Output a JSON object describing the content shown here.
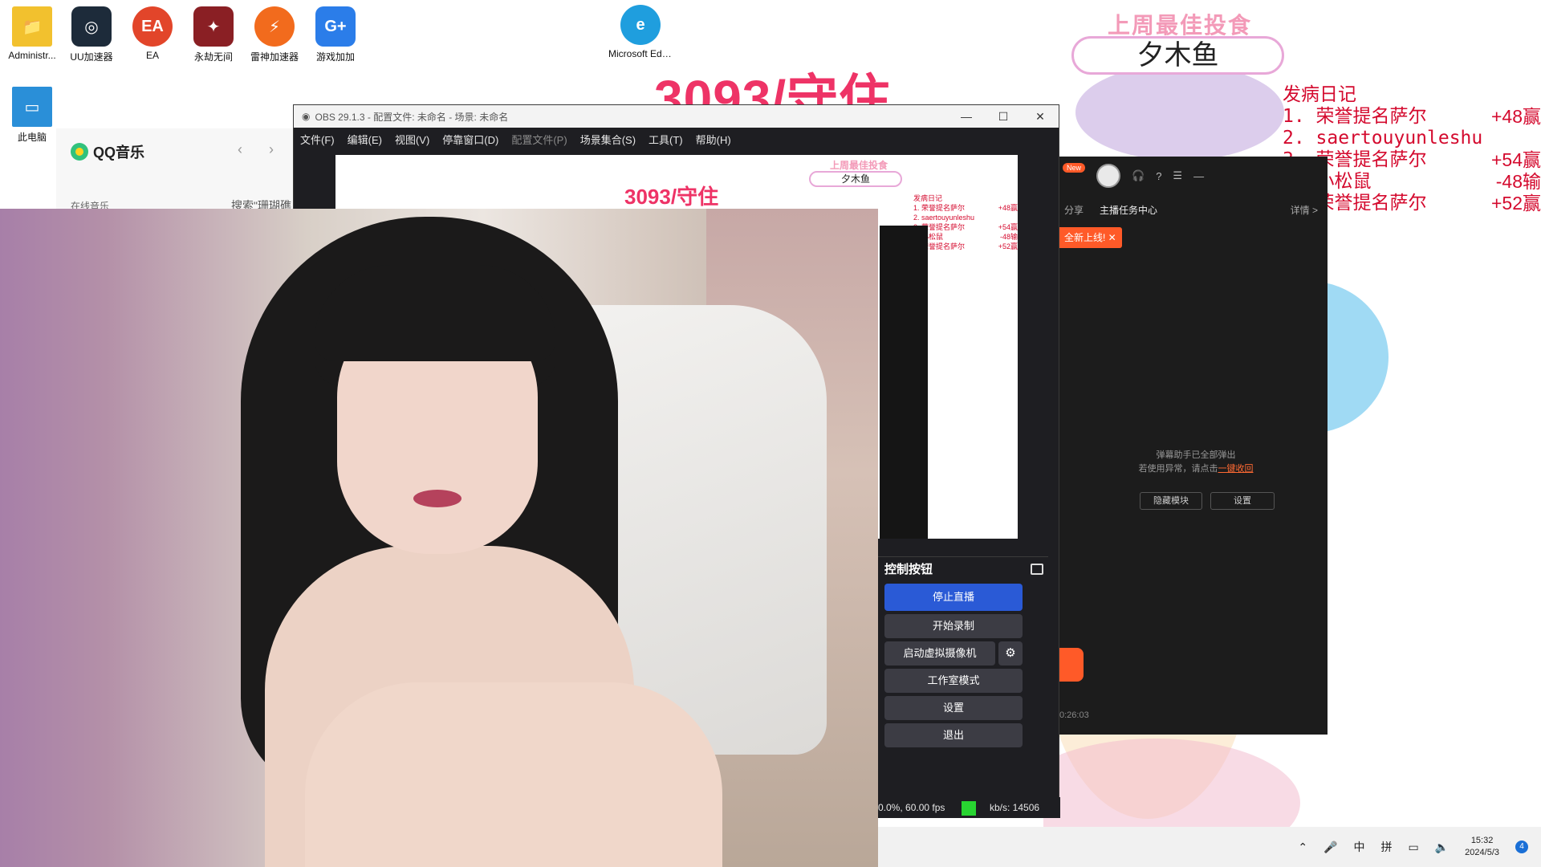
{
  "desktop": {
    "icons": [
      {
        "label": "Administr...",
        "icon": "folder-icon",
        "color": "#f2c12e"
      },
      {
        "label": "UU加速器",
        "icon": "uu-accelerator-icon",
        "color": "#1d2b3a"
      },
      {
        "label": "EA",
        "icon": "ea-icon",
        "color": "#e2452a"
      },
      {
        "label": "永劫无间",
        "icon": "naraka-icon",
        "color": "#8a1f24"
      },
      {
        "label": "雷神加速器",
        "icon": "thunder-accelerator-icon",
        "color": "#f26b1d"
      },
      {
        "label": "游戏加加",
        "icon": "gameplus-icon",
        "color": "#2b7de9"
      },
      {
        "label": "Microsoft Edge",
        "icon": "edge-icon",
        "color": "#1f9ede"
      },
      {
        "label": "此电脑",
        "icon": "computer-icon",
        "color": "#2a8fd8"
      }
    ]
  },
  "overlay": {
    "counter": "3093/守住",
    "best_title": "上周最佳投食",
    "best_name": "夕木鱼",
    "diary_title": "发病日记",
    "diary_rows": [
      {
        "name": "1. 荣誉提名萨尔",
        "result": "+48赢"
      },
      {
        "name": "2. saertouyunleshu",
        "result": ""
      },
      {
        "name": "3. 荣誉提名萨尔",
        "result": "+54赢"
      },
      {
        "name": "4. 小松鼠",
        "result": "-48输"
      },
      {
        "name": "5. 荣誉提名萨尔",
        "result": "+52赢"
      }
    ]
  },
  "qqmusic": {
    "title": "QQ音乐",
    "nav": "‹ ›",
    "section": "在线音乐",
    "search": "搜索\"珊瑚礁"
  },
  "obs": {
    "title": "OBS 29.1.3 - 配置文件: 未命名 - 场景: 未命名",
    "menu": [
      "文件(F)",
      "编辑(E)",
      "视图(V)",
      "停靠窗口(D)",
      "配置文件(P)",
      "场景集合(S)",
      "工具(T)",
      "帮助(H)"
    ],
    "controls_title": "控制按钮",
    "buttons": {
      "stop_stream": "停止直播",
      "start_record": "开始录制",
      "virtual_cam": "启动虚拟摄像机",
      "studio_mode": "工作室模式",
      "settings": "设置",
      "exit": "退出"
    },
    "status_fps": "0.0%, 60.00 fps",
    "status_kbs": "kb/s: 14506",
    "live_color": "#28d431",
    "accent": "#2a5ad6"
  },
  "assistant": {
    "new_badge": "New",
    "tab_share": "分享",
    "tab_tasks": "主播任务中心",
    "detail": "详情 >",
    "toast": "全新上线! ✕",
    "msg_line1": "弹幕助手已全部弹出",
    "msg_line2": "若使用异常，请点击",
    "msg_link": "一键收回",
    "btn_hide": "隐藏模块",
    "btn_settings": "设置",
    "timer": "0:26:03"
  },
  "taskbar": {
    "ime_lang": "中",
    "ime_mode": "拼",
    "time": "15:32",
    "date": "2024/5/3",
    "notifications": "4"
  }
}
